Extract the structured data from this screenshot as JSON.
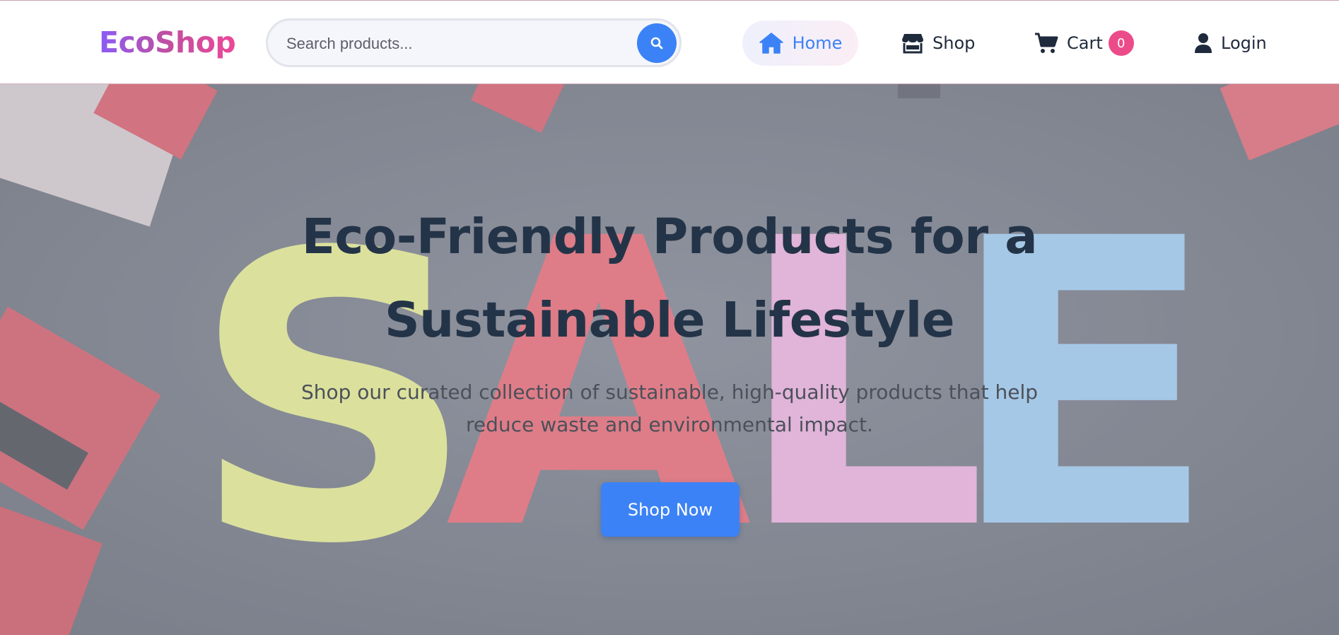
{
  "header": {
    "logo": "EcoShop",
    "search": {
      "placeholder": "Search products...",
      "value": "",
      "icon": "search-icon"
    },
    "nav": {
      "home": {
        "label": "Home",
        "icon": "home-icon",
        "active": true
      },
      "shop": {
        "label": "Shop",
        "icon": "store-icon"
      },
      "cart": {
        "label": "Cart",
        "icon": "cart-icon",
        "count": "0"
      },
      "login": {
        "label": "Login",
        "icon": "user-icon"
      }
    }
  },
  "hero": {
    "background_image": "SALE",
    "title_line1": "Eco-Friendly Products for a",
    "title_line2": "Sustainable Lifestyle",
    "subtitle_line1": "Shop our curated collection of sustainable, high-quality products that help",
    "subtitle_line2": "reduce waste and environmental impact.",
    "cta_label": "Shop Now"
  },
  "colors": {
    "accent": "#3b82f6",
    "brand_gradient_start": "#8b5cf6",
    "brand_gradient_end": "#ec4899",
    "badge": "#ec4b8a",
    "heading": "#243448"
  }
}
